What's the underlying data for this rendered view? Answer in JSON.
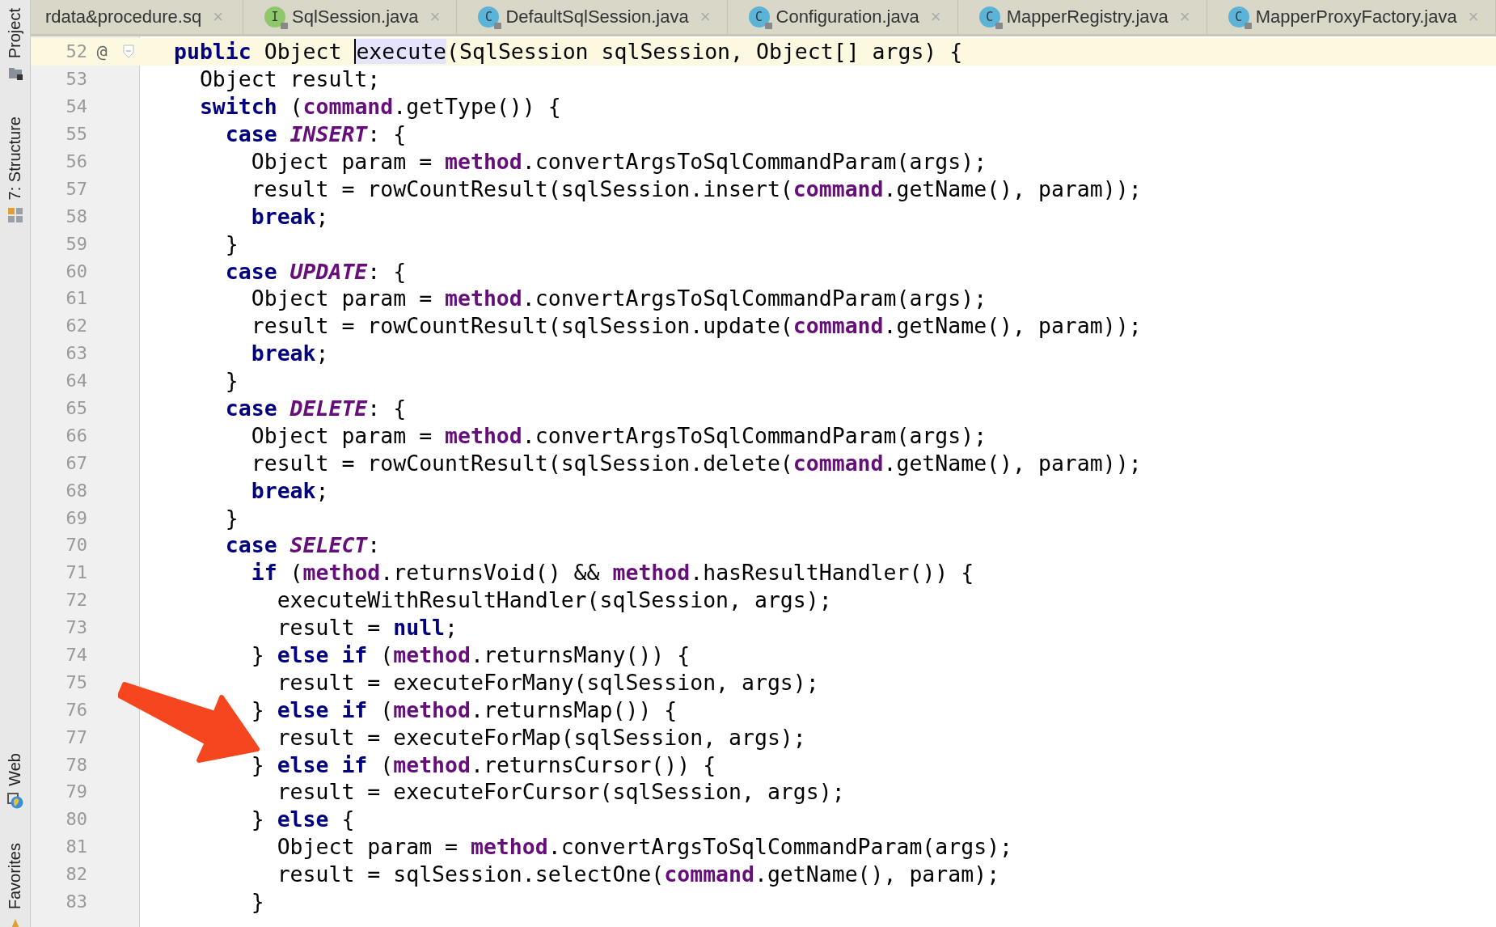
{
  "tool_strip": [
    {
      "label": "Project"
    },
    {
      "label": "7: Structure"
    },
    {
      "label": "Web"
    },
    {
      "label": "Favorites"
    }
  ],
  "tabs": [
    {
      "label": "rdata&procedure.sq",
      "close": "×"
    },
    {
      "label": "SqlSession.java",
      "badge": "I",
      "kind": "interface",
      "close": "×"
    },
    {
      "label": "DefaultSqlSession.java",
      "badge": "C",
      "kind": "class",
      "close": "×"
    },
    {
      "label": "Configuration.java",
      "badge": "C",
      "kind": "class",
      "close": "×"
    },
    {
      "label": "MapperRegistry.java",
      "badge": "C",
      "kind": "class",
      "close": "×"
    },
    {
      "label": "MapperProxyFactory.java",
      "badge": "C",
      "kind": "class",
      "close": "×"
    }
  ],
  "editor": {
    "lines": [
      {
        "number": "52",
        "current": true,
        "marker": "@",
        "fold": true,
        "segments": [
          {
            "kind": "keyword",
            "text": "public"
          },
          {
            "kind": "plain",
            "text": " Object "
          },
          {
            "kind": "highlighted",
            "text": "execute"
          },
          {
            "kind": "plain",
            "text": "(SqlSession sqlSession, Object[] args) {"
          }
        ]
      },
      {
        "number": "53",
        "current": false,
        "segments": [
          {
            "kind": "plain",
            "text": "  Object result;"
          }
        ]
      },
      {
        "number": "54",
        "current": false,
        "segments": [
          {
            "kind": "keyword",
            "text": "  switch"
          },
          {
            "kind": "plain",
            "text": " ("
          },
          {
            "kind": "field",
            "text": "command"
          },
          {
            "kind": "plain",
            "text": ".getType()) {"
          }
        ]
      },
      {
        "number": "55",
        "current": false,
        "segments": [
          {
            "kind": "keyword",
            "text": "    case "
          },
          {
            "kind": "constant",
            "text": "INSERT"
          },
          {
            "kind": "plain",
            "text": ": {"
          }
        ]
      },
      {
        "number": "56",
        "current": false,
        "segments": [
          {
            "kind": "plain",
            "text": "      Object param = "
          },
          {
            "kind": "field",
            "text": "method"
          },
          {
            "kind": "plain",
            "text": ".convertArgsToSqlCommandParam(args);"
          }
        ]
      },
      {
        "number": "57",
        "current": false,
        "segments": [
          {
            "kind": "plain",
            "text": "      result = rowCountResult(sqlSession.insert("
          },
          {
            "kind": "field",
            "text": "command"
          },
          {
            "kind": "plain",
            "text": ".getName(), param));"
          }
        ]
      },
      {
        "number": "58",
        "current": false,
        "segments": [
          {
            "kind": "keyword",
            "text": "      break"
          },
          {
            "kind": "plain",
            "text": ";"
          }
        ]
      },
      {
        "number": "59",
        "current": false,
        "segments": [
          {
            "kind": "plain",
            "text": "    }"
          }
        ]
      },
      {
        "number": "60",
        "current": false,
        "segments": [
          {
            "kind": "keyword",
            "text": "    case "
          },
          {
            "kind": "constant",
            "text": "UPDATE"
          },
          {
            "kind": "plain",
            "text": ": {"
          }
        ]
      },
      {
        "number": "61",
        "current": false,
        "segments": [
          {
            "kind": "plain",
            "text": "      Object param = "
          },
          {
            "kind": "field",
            "text": "method"
          },
          {
            "kind": "plain",
            "text": ".convertArgsToSqlCommandParam(args);"
          }
        ]
      },
      {
        "number": "62",
        "current": false,
        "segments": [
          {
            "kind": "plain",
            "text": "      result = rowCountResult(sqlSession.update("
          },
          {
            "kind": "field",
            "text": "command"
          },
          {
            "kind": "plain",
            "text": ".getName(), param));"
          }
        ]
      },
      {
        "number": "63",
        "current": false,
        "segments": [
          {
            "kind": "keyword",
            "text": "      break"
          },
          {
            "kind": "plain",
            "text": ";"
          }
        ]
      },
      {
        "number": "64",
        "current": false,
        "segments": [
          {
            "kind": "plain",
            "text": "    }"
          }
        ]
      },
      {
        "number": "65",
        "current": false,
        "segments": [
          {
            "kind": "keyword",
            "text": "    case "
          },
          {
            "kind": "constant",
            "text": "DELETE"
          },
          {
            "kind": "plain",
            "text": ": {"
          }
        ]
      },
      {
        "number": "66",
        "current": false,
        "segments": [
          {
            "kind": "plain",
            "text": "      Object param = "
          },
          {
            "kind": "field",
            "text": "method"
          },
          {
            "kind": "plain",
            "text": ".convertArgsToSqlCommandParam(args);"
          }
        ]
      },
      {
        "number": "67",
        "current": false,
        "segments": [
          {
            "kind": "plain",
            "text": "      result = rowCountResult(sqlSession.delete("
          },
          {
            "kind": "field",
            "text": "command"
          },
          {
            "kind": "plain",
            "text": ".getName(), param));"
          }
        ]
      },
      {
        "number": "68",
        "current": false,
        "segments": [
          {
            "kind": "keyword",
            "text": "      break"
          },
          {
            "kind": "plain",
            "text": ";"
          }
        ]
      },
      {
        "number": "69",
        "current": false,
        "segments": [
          {
            "kind": "plain",
            "text": "    }"
          }
        ]
      },
      {
        "number": "70",
        "current": false,
        "segments": [
          {
            "kind": "keyword",
            "text": "    case "
          },
          {
            "kind": "constant",
            "text": "SELECT"
          },
          {
            "kind": "plain",
            "text": ":"
          }
        ]
      },
      {
        "number": "71",
        "current": false,
        "segments": [
          {
            "kind": "keyword",
            "text": "      if"
          },
          {
            "kind": "plain",
            "text": " ("
          },
          {
            "kind": "field",
            "text": "method"
          },
          {
            "kind": "plain",
            "text": ".returnsVoid() && "
          },
          {
            "kind": "field",
            "text": "method"
          },
          {
            "kind": "plain",
            "text": ".hasResultHandler()) {"
          }
        ]
      },
      {
        "number": "72",
        "current": false,
        "segments": [
          {
            "kind": "plain",
            "text": "        executeWithResultHandler(sqlSession, args);"
          }
        ]
      },
      {
        "number": "73",
        "current": false,
        "segments": [
          {
            "kind": "plain",
            "text": "        result = "
          },
          {
            "kind": "keyword",
            "text": "null"
          },
          {
            "kind": "plain",
            "text": ";"
          }
        ]
      },
      {
        "number": "74",
        "current": false,
        "segments": [
          {
            "kind": "plain",
            "text": "      } "
          },
          {
            "kind": "keyword",
            "text": "else if"
          },
          {
            "kind": "plain",
            "text": " ("
          },
          {
            "kind": "field",
            "text": "method"
          },
          {
            "kind": "plain",
            "text": ".returnsMany()) {"
          }
        ]
      },
      {
        "number": "75",
        "current": false,
        "segments": [
          {
            "kind": "plain",
            "text": "        result = executeForMany(sqlSession, args);"
          }
        ]
      },
      {
        "number": "76",
        "current": false,
        "segments": [
          {
            "kind": "plain",
            "text": "      } "
          },
          {
            "kind": "keyword",
            "text": "else if"
          },
          {
            "kind": "plain",
            "text": " ("
          },
          {
            "kind": "field",
            "text": "method"
          },
          {
            "kind": "plain",
            "text": ".returnsMap()) {"
          }
        ]
      },
      {
        "number": "77",
        "current": false,
        "segments": [
          {
            "kind": "plain",
            "text": "        result = executeForMap(sqlSession, args);"
          }
        ]
      },
      {
        "number": "78",
        "current": false,
        "segments": [
          {
            "kind": "plain",
            "text": "      } "
          },
          {
            "kind": "keyword",
            "text": "else if"
          },
          {
            "kind": "plain",
            "text": " ("
          },
          {
            "kind": "field",
            "text": "method"
          },
          {
            "kind": "plain",
            "text": ".returnsCursor()) {"
          }
        ]
      },
      {
        "number": "79",
        "current": false,
        "segments": [
          {
            "kind": "plain",
            "text": "        result = executeForCursor(sqlSession, args);"
          }
        ]
      },
      {
        "number": "80",
        "current": false,
        "segments": [
          {
            "kind": "plain",
            "text": "      } "
          },
          {
            "kind": "keyword",
            "text": "else"
          },
          {
            "kind": "plain",
            "text": " {"
          }
        ]
      },
      {
        "number": "81",
        "current": false,
        "segments": [
          {
            "kind": "plain",
            "text": "        Object param = "
          },
          {
            "kind": "field",
            "text": "method"
          },
          {
            "kind": "plain",
            "text": ".convertArgsToSqlCommandParam(args);"
          }
        ]
      },
      {
        "number": "82",
        "current": false,
        "segments": [
          {
            "kind": "plain",
            "text": "        result = sqlSession.selectOne("
          },
          {
            "kind": "field",
            "text": "command"
          },
          {
            "kind": "plain",
            "text": ".getName(), param);"
          }
        ]
      },
      {
        "number": "83",
        "current": false,
        "segments": [
          {
            "kind": "plain",
            "text": "      }"
          }
        ]
      }
    ]
  }
}
